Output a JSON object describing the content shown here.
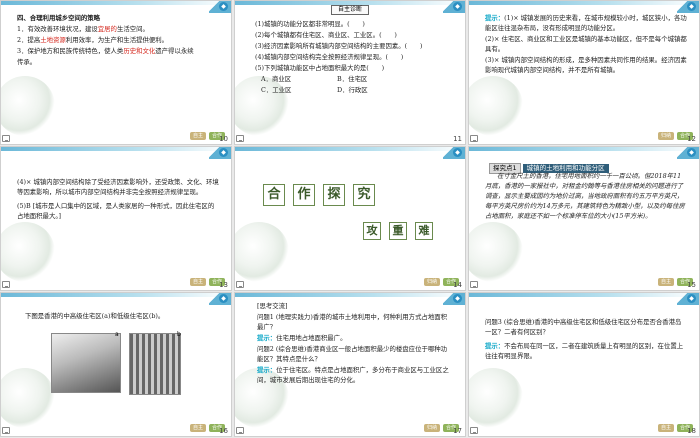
{
  "slides": [
    {
      "num": "10",
      "lines": [
        "四、合理利用城乡空间的策略",
        "1．有效改善环境状况，建设",
        "宜居的",
        "生活空间。",
        "2．提高",
        "土地资源",
        "利用效率，为生产和生活提供便利。",
        "3．保护地方和民族传统特色，使人类",
        "历史和文化",
        "遗产得以永续",
        "传承。"
      ],
      "buttons": [
        "自主",
        "合作"
      ]
    },
    {
      "num": "11",
      "header": "自主诊断",
      "lines": [
        "(1)城镇的功能分区都非常明显。(　　)",
        "(2)每个城镇都有住宅区、商业区、工业区。(　　)",
        "(3)经济因素影响所有城镇内部空间结构的主要因素。(　　)",
        "(4)城镇内部空间结构完全按照经济规律呈现。(　　)",
        "(5)下列城镇功能区中占地面积最大的是(　　)",
        "A．商业区",
        "B．住宅区",
        "C．工业区",
        "D．行政区"
      ]
    },
    {
      "num": "12",
      "lines": [
        "提示：",
        "(1)× 城镇发展的历史来看，在城市规模较小时，城区狭小，各功能区往往混杂布局，没有形成明显的功能分区。",
        "(2)× 住宅区、商业区和工业区是城镇的基本功能区，但不是每个城镇都具有。",
        "(3)× 城镇内部空间结构的形成，是多种因素共同作用的结果。经济因素影响现代城镇内部空间结构，并不是所有城镇。"
      ],
      "buttons": [
        "归纳",
        "合作"
      ]
    },
    {
      "num": "13",
      "lines": [
        "(4)× 城镇内部空间结构除了受经济因素影响外，还受政策、文化、环境等因素影响，所以城市内部空间结构并非完全按照经济规律呈现。",
        "(5)B [城市是人口集中的区域，是人类家居的一种形式，因此住宅区的占地面积最大。]"
      ],
      "buttons": [
        "自主",
        "合作"
      ]
    },
    {
      "num": "14",
      "title_chars": [
        "合",
        "作",
        "探",
        "究"
      ],
      "sub_chars": [
        "攻",
        "重",
        "难"
      ],
      "buttons": [
        "归纳",
        "合作"
      ]
    },
    {
      "num": "15",
      "tag": "探究点1",
      "tagtitle": "城镇的土地利用和功能分区",
      "lines": [
        "在寸金尺土的香港，住宅用地面积约一千一百公顷。但2018年11月底，香港的一家报社中，对租金约翰等与香港住房相关的问题进行了调查，显示主要成因约为地价过高，当地政府面积有约五万平方英尺，每平方英尺房价约为14万多元，其建筑特色为精致小型，以及约每住房占地面积，家庭还不如一个标准停车位的大小(15平方米)。"
      ],
      "buttons": [
        "自主",
        "合作"
      ]
    },
    {
      "num": "16",
      "lines": [
        "下图是香港的中高级住宅区(a)和低级住宅区(b)。"
      ],
      "photo_labels": [
        "a",
        "b"
      ],
      "buttons": [
        "自主",
        "合作"
      ]
    },
    {
      "num": "17",
      "header": "[思考交流]",
      "lines": [
        "问题1 (地理实践力)香港的城市土地利用中，何种利用方式占地面积最广？",
        "提示：",
        "住宅用地占地面积最广。",
        "问题2 (综合思维)香港商业区一般占地面积最少的楼盘应位于哪种功能区？其特点是什么？",
        "提示：",
        "位于住宅区。特点是占地面积广，多分布于商业区与工业区之间，城市发展后期出现住宅的分化。"
      ],
      "buttons": [
        "归纳",
        "合作"
      ]
    },
    {
      "num": "18",
      "lines": [
        "问题3 (综合思维)香港的中高级住宅区和低级住宅区分布是否合香港岛一区？二者有何区别？",
        "提示：",
        "不会布局在同一区，二者在建筑质量上有明显的区别，在位置上往往有明显界限。"
      ],
      "buttons": [
        "自主",
        "合作"
      ]
    }
  ]
}
